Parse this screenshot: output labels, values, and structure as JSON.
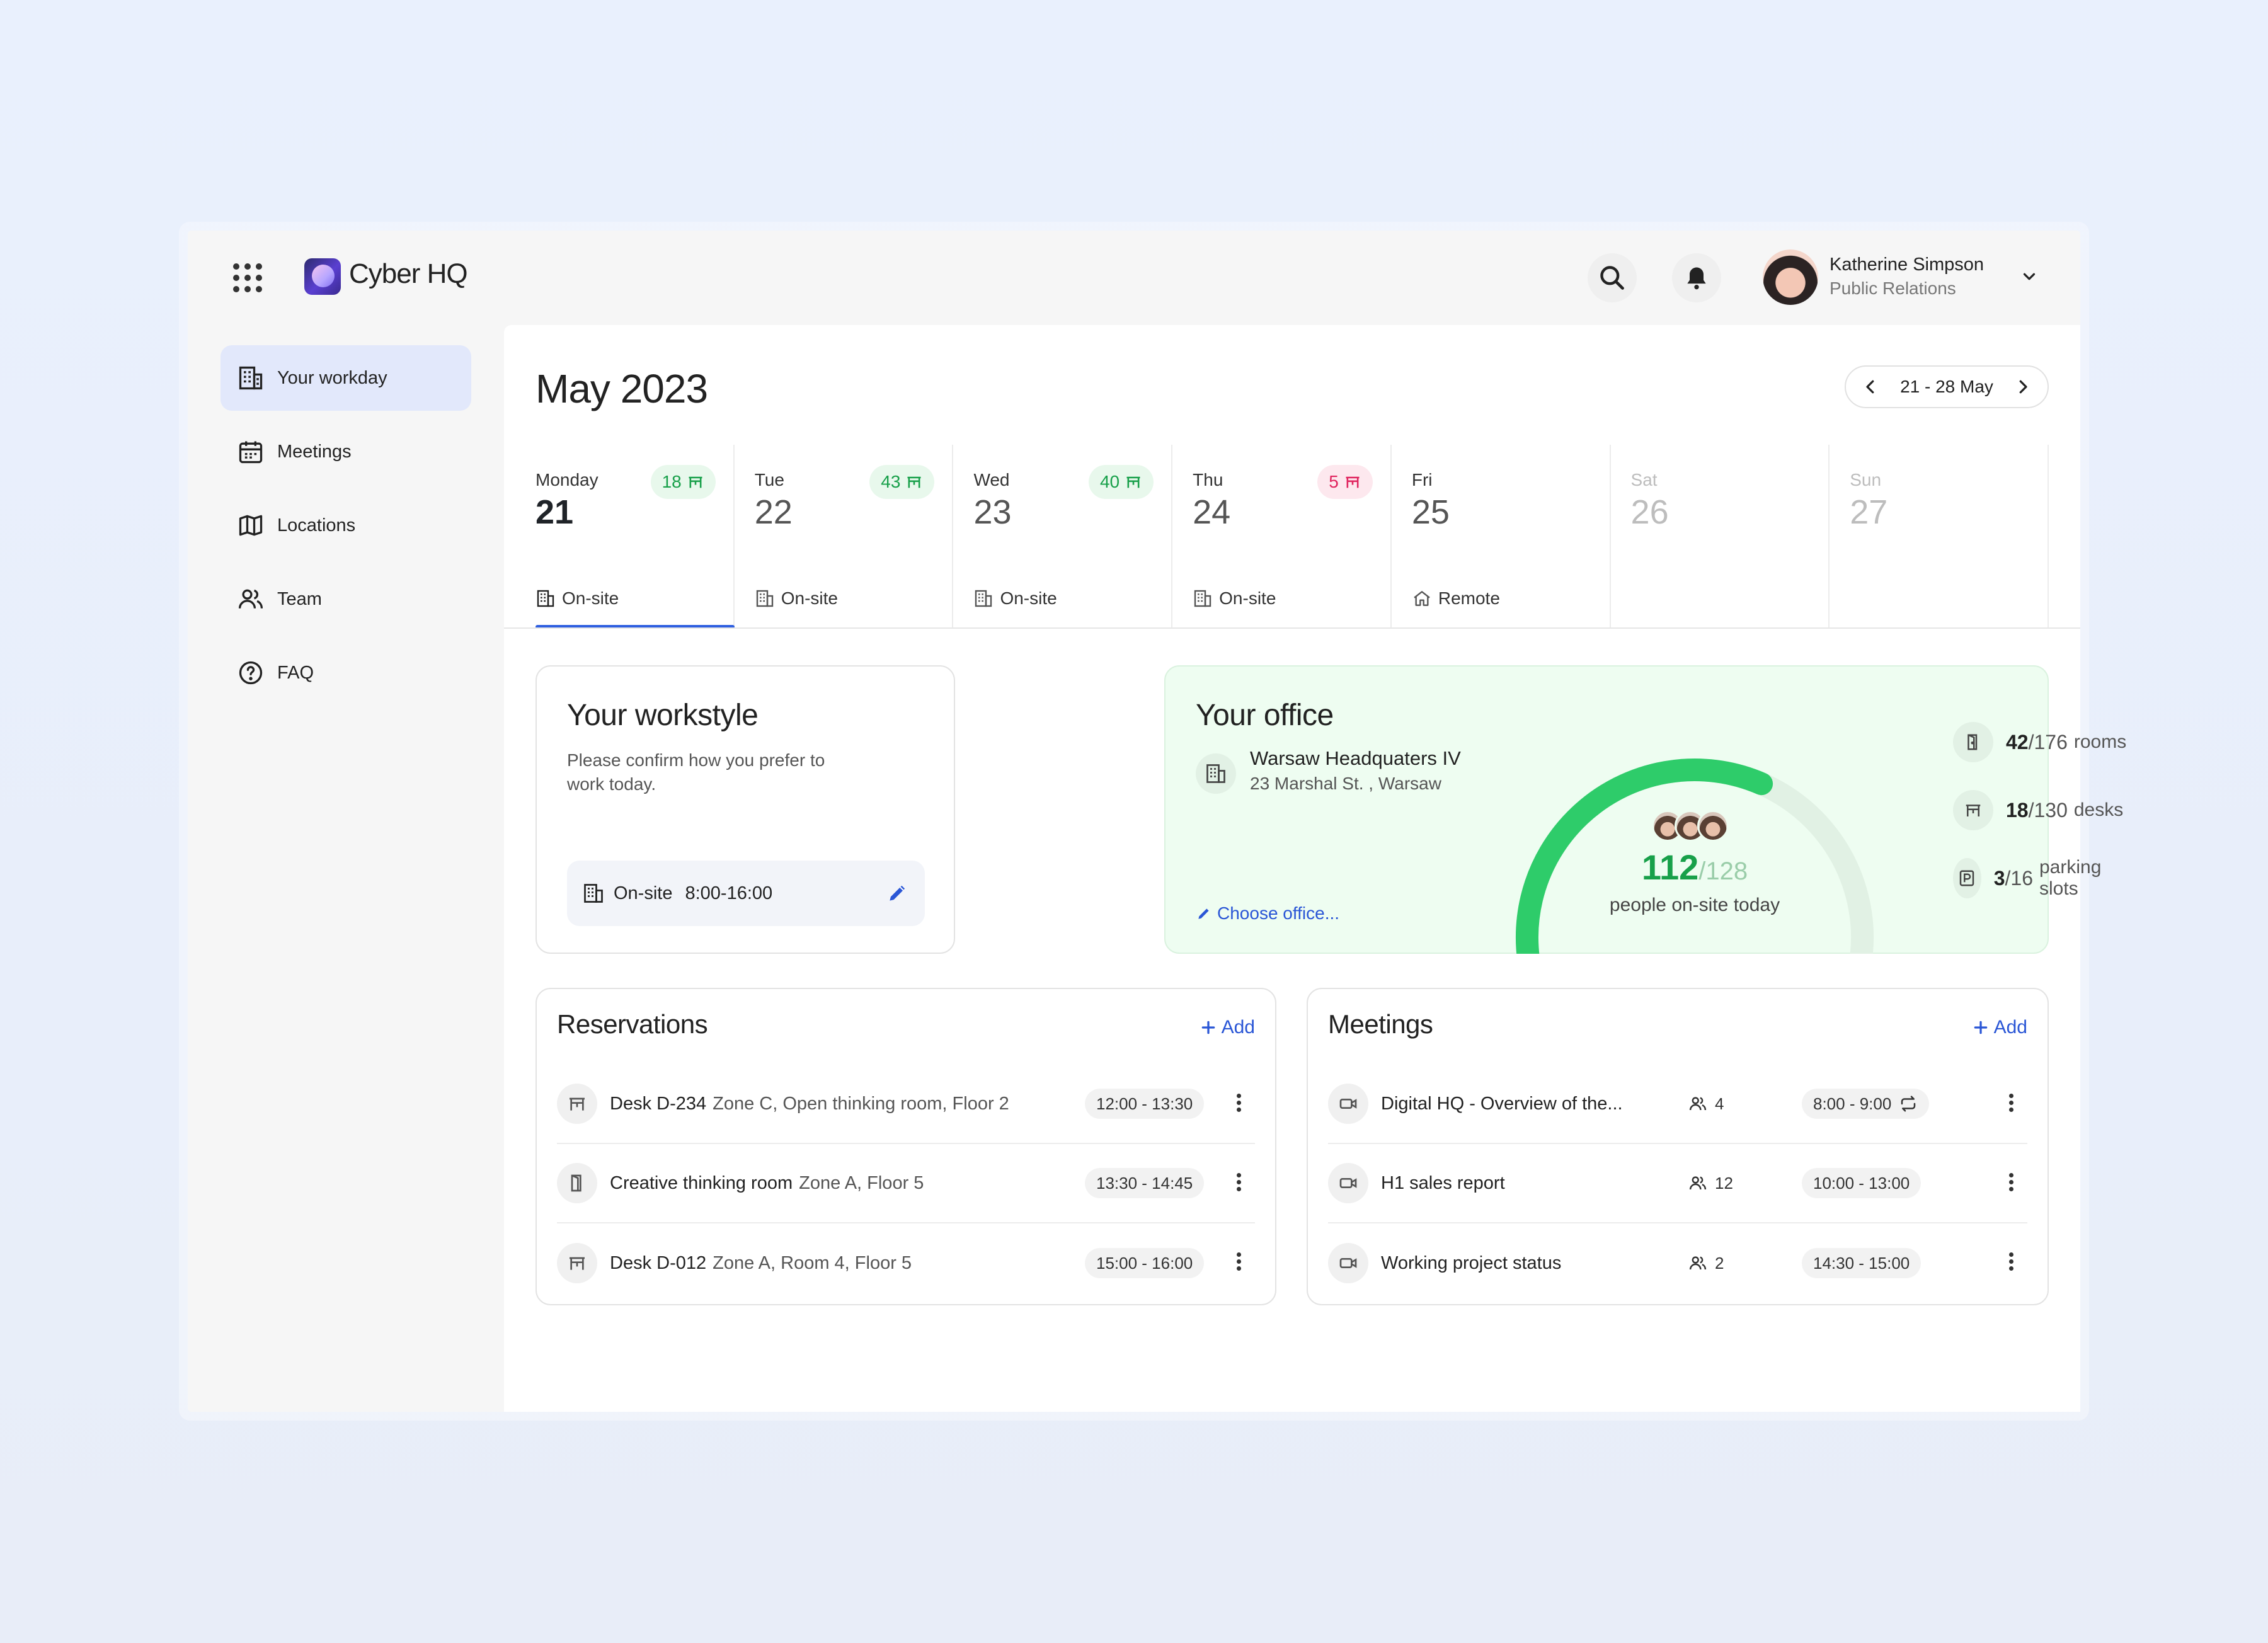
{
  "app": {
    "title": "Cyber HQ"
  },
  "user": {
    "name": "Katherine Simpson",
    "role": "Public Relations"
  },
  "sidebar": {
    "items": [
      {
        "label": "Your workday",
        "icon": "building-icon",
        "active": true
      },
      {
        "label": "Meetings",
        "icon": "calendar-icon"
      },
      {
        "label": "Locations",
        "icon": "map-icon"
      },
      {
        "label": "Team",
        "icon": "people-icon"
      },
      {
        "label": "FAQ",
        "icon": "help-icon"
      }
    ]
  },
  "calendar": {
    "month": "May 2023",
    "range": "21 - 28 May",
    "days": [
      {
        "name": "Monday",
        "num": "21",
        "badge": "18",
        "badge_color": "#18a04a",
        "mode": "On-site",
        "selected": true
      },
      {
        "name": "Tue",
        "num": "22",
        "badge": "43",
        "badge_color": "#18a04a",
        "mode": "On-site"
      },
      {
        "name": "Wed",
        "num": "23",
        "badge": "40",
        "badge_color": "#18a04a",
        "mode": "On-site"
      },
      {
        "name": "Thu",
        "num": "24",
        "badge": "5",
        "badge_color": "#e0245e",
        "mode": "On-site"
      },
      {
        "name": "Fri",
        "num": "25",
        "mode": "Remote"
      },
      {
        "name": "Sat",
        "num": "26"
      },
      {
        "name": "Sun",
        "num": "27"
      }
    ]
  },
  "workstyle": {
    "title": "Your workstyle",
    "subtitle": "Please confirm how you prefer to work today.",
    "mode": "On-site",
    "hours": "8:00-16:00"
  },
  "office": {
    "title": "Your office",
    "name": "Warsaw Headquaters IV",
    "address": "23 Marshal St. , Warsaw",
    "choose_label": "Choose office...",
    "people": "112",
    "people_total": "/128",
    "people_label": "people on-site today",
    "occupancy_fraction": 0.875,
    "stats": [
      {
        "n": "42",
        "total": "/176",
        "label": "rooms",
        "icon": "door-icon"
      },
      {
        "n": "18",
        "total": "/130",
        "label": "desks",
        "icon": "desk-icon"
      },
      {
        "n": "3",
        "total": "/16",
        "label": "parking slots",
        "icon": "parking-icon"
      }
    ]
  },
  "reservations": {
    "title": "Reservations",
    "add_label": "Add",
    "items": [
      {
        "name": "Desk D-234",
        "detail": "Zone C, Open thinking room, Floor 2",
        "time": "12:00 - 13:30",
        "icon": "desk-icon"
      },
      {
        "name": "Creative thinking room",
        "detail": "Zone A, Floor 5",
        "time": "13:30 - 14:45",
        "icon": "door-icon"
      },
      {
        "name": "Desk D-012",
        "detail": "Zone A, Room 4, Floor 5",
        "time": "15:00 - 16:00",
        "icon": "desk-icon"
      }
    ]
  },
  "meetings": {
    "title": "Meetings",
    "add_label": "Add",
    "items": [
      {
        "name": "Digital HQ - Overview of the...",
        "people": "4",
        "time": "8:00 - 9:00",
        "recurring": true
      },
      {
        "name": "H1 sales report",
        "people": "12",
        "time": "10:00 - 13:00"
      },
      {
        "name": "Working project status",
        "people": "2",
        "time": "14:30 - 15:00"
      }
    ]
  },
  "colors": {
    "accent": "#2f5fe0",
    "success": "#18a04a",
    "danger": "#e0245e",
    "office_bg": "#eefdf1"
  }
}
